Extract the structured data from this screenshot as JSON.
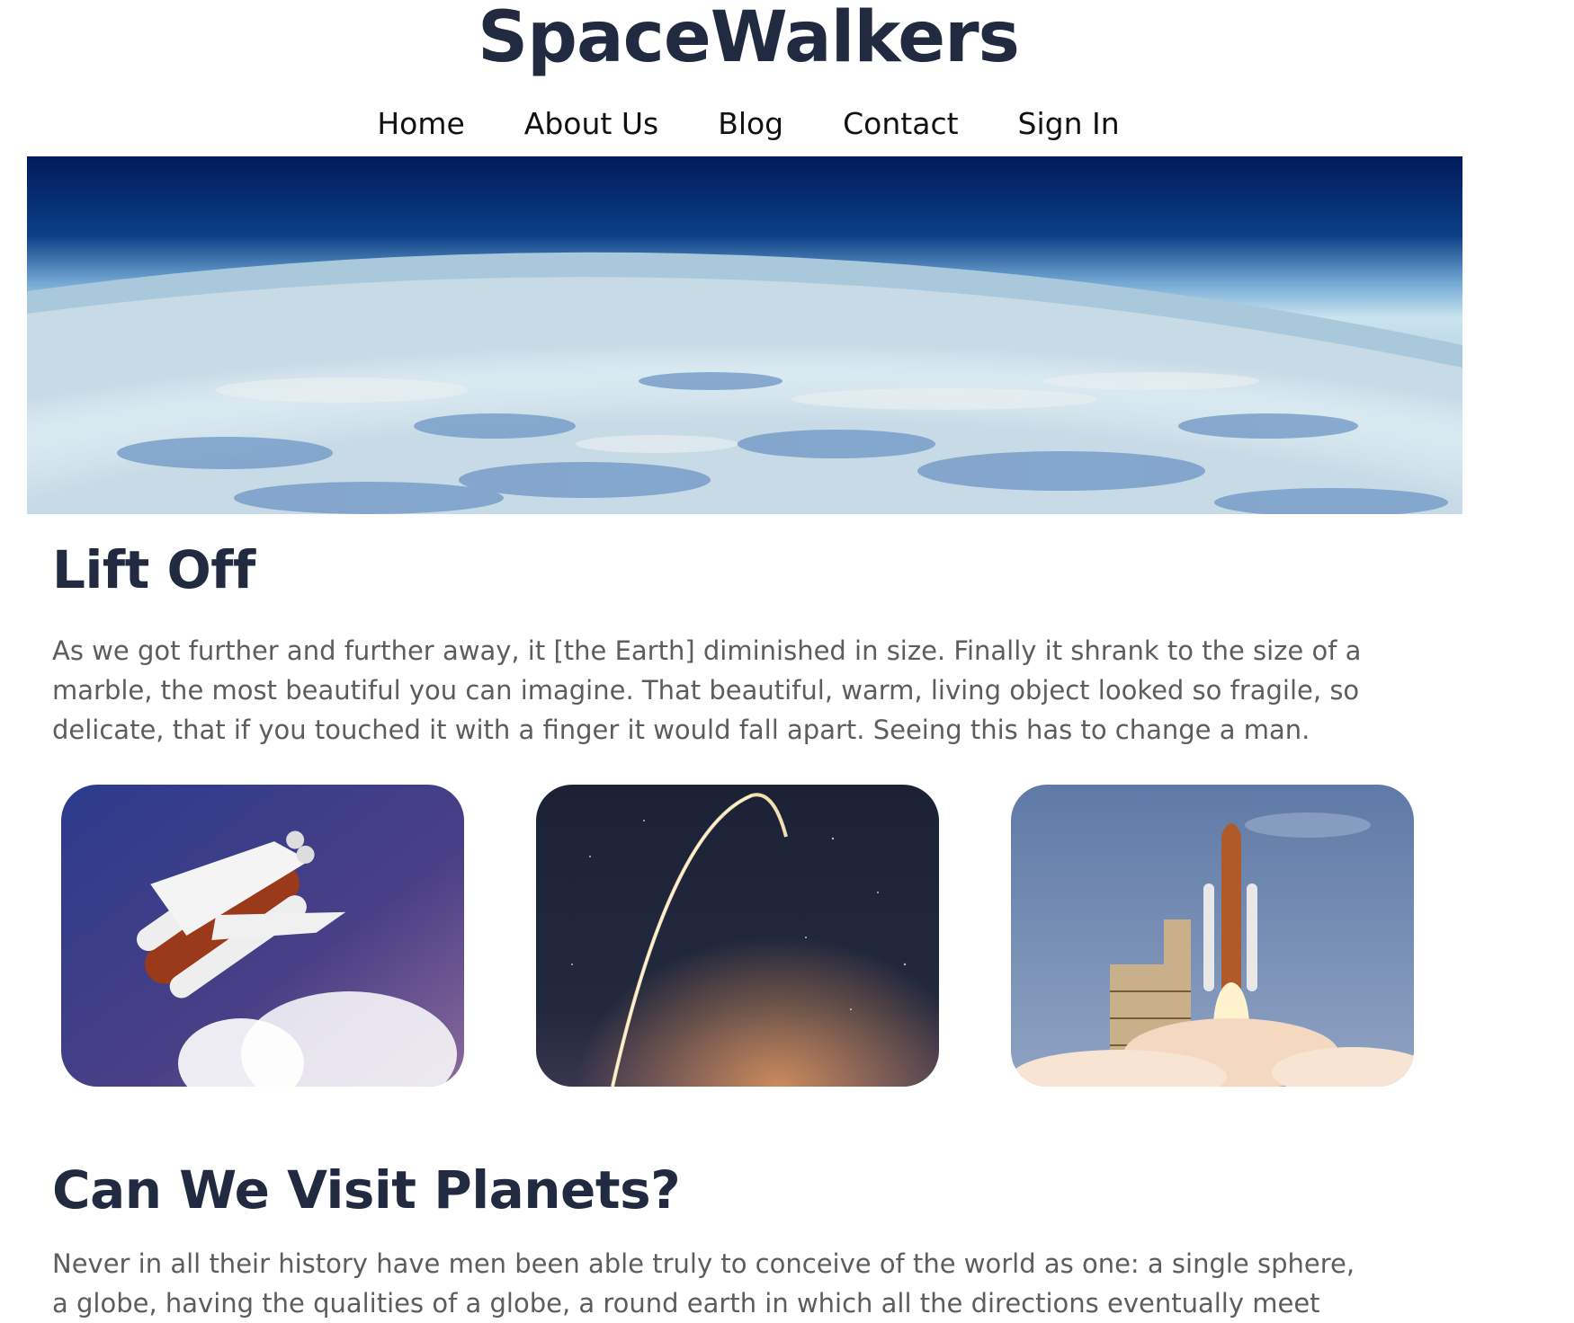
{
  "site": {
    "title": "SpaceWalkers"
  },
  "nav": {
    "items": [
      {
        "label": "Home"
      },
      {
        "label": "About Us"
      },
      {
        "label": "Blog"
      },
      {
        "label": "Contact"
      },
      {
        "label": "Sign In"
      }
    ]
  },
  "hero": {
    "image": "earth-horizon-from-space-image"
  },
  "sections": [
    {
      "heading": "Lift Off",
      "body": "As we got further and further away, it [the Earth] diminished in size. Finally it shrank to the size of a marble, the most beautiful you can imagine. That beautiful, warm, living object looked so fragile, so delicate, that if you touched it with a finger it would fall apart. Seeing this has to change a man."
    },
    {
      "heading": "Can We Visit Planets?",
      "body": "Never in all their history have men been able truly to conceive of the world as one: a single sphere, a globe, having the qualities of a globe, a round earth in which all the directions eventually meet"
    }
  ],
  "gallery": {
    "images": [
      {
        "image": "space-shuttle-ascending-image"
      },
      {
        "image": "rocket-launch-trail-at-night-image"
      },
      {
        "image": "rocket-on-launch-pad-image"
      }
    ]
  },
  "colors": {
    "heading": "#212a40",
    "body_text": "#5d5d5d",
    "nav_text": "#111111",
    "background": "#ffffff"
  }
}
